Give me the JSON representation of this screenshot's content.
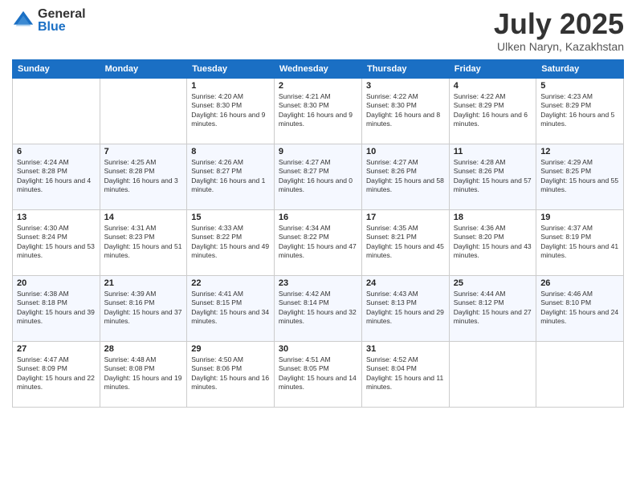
{
  "logo": {
    "general": "General",
    "blue": "Blue"
  },
  "title": "July 2025",
  "location": "Ulken Naryn, Kazakhstan",
  "days_of_week": [
    "Sunday",
    "Monday",
    "Tuesday",
    "Wednesday",
    "Thursday",
    "Friday",
    "Saturday"
  ],
  "weeks": [
    [
      {
        "day": "",
        "sunrise": "",
        "sunset": "",
        "daylight": ""
      },
      {
        "day": "",
        "sunrise": "",
        "sunset": "",
        "daylight": ""
      },
      {
        "day": "1",
        "sunrise": "Sunrise: 4:20 AM",
        "sunset": "Sunset: 8:30 PM",
        "daylight": "Daylight: 16 hours and 9 minutes."
      },
      {
        "day": "2",
        "sunrise": "Sunrise: 4:21 AM",
        "sunset": "Sunset: 8:30 PM",
        "daylight": "Daylight: 16 hours and 9 minutes."
      },
      {
        "day": "3",
        "sunrise": "Sunrise: 4:22 AM",
        "sunset": "Sunset: 8:30 PM",
        "daylight": "Daylight: 16 hours and 8 minutes."
      },
      {
        "day": "4",
        "sunrise": "Sunrise: 4:22 AM",
        "sunset": "Sunset: 8:29 PM",
        "daylight": "Daylight: 16 hours and 6 minutes."
      },
      {
        "day": "5",
        "sunrise": "Sunrise: 4:23 AM",
        "sunset": "Sunset: 8:29 PM",
        "daylight": "Daylight: 16 hours and 5 minutes."
      }
    ],
    [
      {
        "day": "6",
        "sunrise": "Sunrise: 4:24 AM",
        "sunset": "Sunset: 8:28 PM",
        "daylight": "Daylight: 16 hours and 4 minutes."
      },
      {
        "day": "7",
        "sunrise": "Sunrise: 4:25 AM",
        "sunset": "Sunset: 8:28 PM",
        "daylight": "Daylight: 16 hours and 3 minutes."
      },
      {
        "day": "8",
        "sunrise": "Sunrise: 4:26 AM",
        "sunset": "Sunset: 8:27 PM",
        "daylight": "Daylight: 16 hours and 1 minute."
      },
      {
        "day": "9",
        "sunrise": "Sunrise: 4:27 AM",
        "sunset": "Sunset: 8:27 PM",
        "daylight": "Daylight: 16 hours and 0 minutes."
      },
      {
        "day": "10",
        "sunrise": "Sunrise: 4:27 AM",
        "sunset": "Sunset: 8:26 PM",
        "daylight": "Daylight: 15 hours and 58 minutes."
      },
      {
        "day": "11",
        "sunrise": "Sunrise: 4:28 AM",
        "sunset": "Sunset: 8:26 PM",
        "daylight": "Daylight: 15 hours and 57 minutes."
      },
      {
        "day": "12",
        "sunrise": "Sunrise: 4:29 AM",
        "sunset": "Sunset: 8:25 PM",
        "daylight": "Daylight: 15 hours and 55 minutes."
      }
    ],
    [
      {
        "day": "13",
        "sunrise": "Sunrise: 4:30 AM",
        "sunset": "Sunset: 8:24 PM",
        "daylight": "Daylight: 15 hours and 53 minutes."
      },
      {
        "day": "14",
        "sunrise": "Sunrise: 4:31 AM",
        "sunset": "Sunset: 8:23 PM",
        "daylight": "Daylight: 15 hours and 51 minutes."
      },
      {
        "day": "15",
        "sunrise": "Sunrise: 4:33 AM",
        "sunset": "Sunset: 8:22 PM",
        "daylight": "Daylight: 15 hours and 49 minutes."
      },
      {
        "day": "16",
        "sunrise": "Sunrise: 4:34 AM",
        "sunset": "Sunset: 8:22 PM",
        "daylight": "Daylight: 15 hours and 47 minutes."
      },
      {
        "day": "17",
        "sunrise": "Sunrise: 4:35 AM",
        "sunset": "Sunset: 8:21 PM",
        "daylight": "Daylight: 15 hours and 45 minutes."
      },
      {
        "day": "18",
        "sunrise": "Sunrise: 4:36 AM",
        "sunset": "Sunset: 8:20 PM",
        "daylight": "Daylight: 15 hours and 43 minutes."
      },
      {
        "day": "19",
        "sunrise": "Sunrise: 4:37 AM",
        "sunset": "Sunset: 8:19 PM",
        "daylight": "Daylight: 15 hours and 41 minutes."
      }
    ],
    [
      {
        "day": "20",
        "sunrise": "Sunrise: 4:38 AM",
        "sunset": "Sunset: 8:18 PM",
        "daylight": "Daylight: 15 hours and 39 minutes."
      },
      {
        "day": "21",
        "sunrise": "Sunrise: 4:39 AM",
        "sunset": "Sunset: 8:16 PM",
        "daylight": "Daylight: 15 hours and 37 minutes."
      },
      {
        "day": "22",
        "sunrise": "Sunrise: 4:41 AM",
        "sunset": "Sunset: 8:15 PM",
        "daylight": "Daylight: 15 hours and 34 minutes."
      },
      {
        "day": "23",
        "sunrise": "Sunrise: 4:42 AM",
        "sunset": "Sunset: 8:14 PM",
        "daylight": "Daylight: 15 hours and 32 minutes."
      },
      {
        "day": "24",
        "sunrise": "Sunrise: 4:43 AM",
        "sunset": "Sunset: 8:13 PM",
        "daylight": "Daylight: 15 hours and 29 minutes."
      },
      {
        "day": "25",
        "sunrise": "Sunrise: 4:44 AM",
        "sunset": "Sunset: 8:12 PM",
        "daylight": "Daylight: 15 hours and 27 minutes."
      },
      {
        "day": "26",
        "sunrise": "Sunrise: 4:46 AM",
        "sunset": "Sunset: 8:10 PM",
        "daylight": "Daylight: 15 hours and 24 minutes."
      }
    ],
    [
      {
        "day": "27",
        "sunrise": "Sunrise: 4:47 AM",
        "sunset": "Sunset: 8:09 PM",
        "daylight": "Daylight: 15 hours and 22 minutes."
      },
      {
        "day": "28",
        "sunrise": "Sunrise: 4:48 AM",
        "sunset": "Sunset: 8:08 PM",
        "daylight": "Daylight: 15 hours and 19 minutes."
      },
      {
        "day": "29",
        "sunrise": "Sunrise: 4:50 AM",
        "sunset": "Sunset: 8:06 PM",
        "daylight": "Daylight: 15 hours and 16 minutes."
      },
      {
        "day": "30",
        "sunrise": "Sunrise: 4:51 AM",
        "sunset": "Sunset: 8:05 PM",
        "daylight": "Daylight: 15 hours and 14 minutes."
      },
      {
        "day": "31",
        "sunrise": "Sunrise: 4:52 AM",
        "sunset": "Sunset: 8:04 PM",
        "daylight": "Daylight: 15 hours and 11 minutes."
      },
      {
        "day": "",
        "sunrise": "",
        "sunset": "",
        "daylight": ""
      },
      {
        "day": "",
        "sunrise": "",
        "sunset": "",
        "daylight": ""
      }
    ]
  ]
}
